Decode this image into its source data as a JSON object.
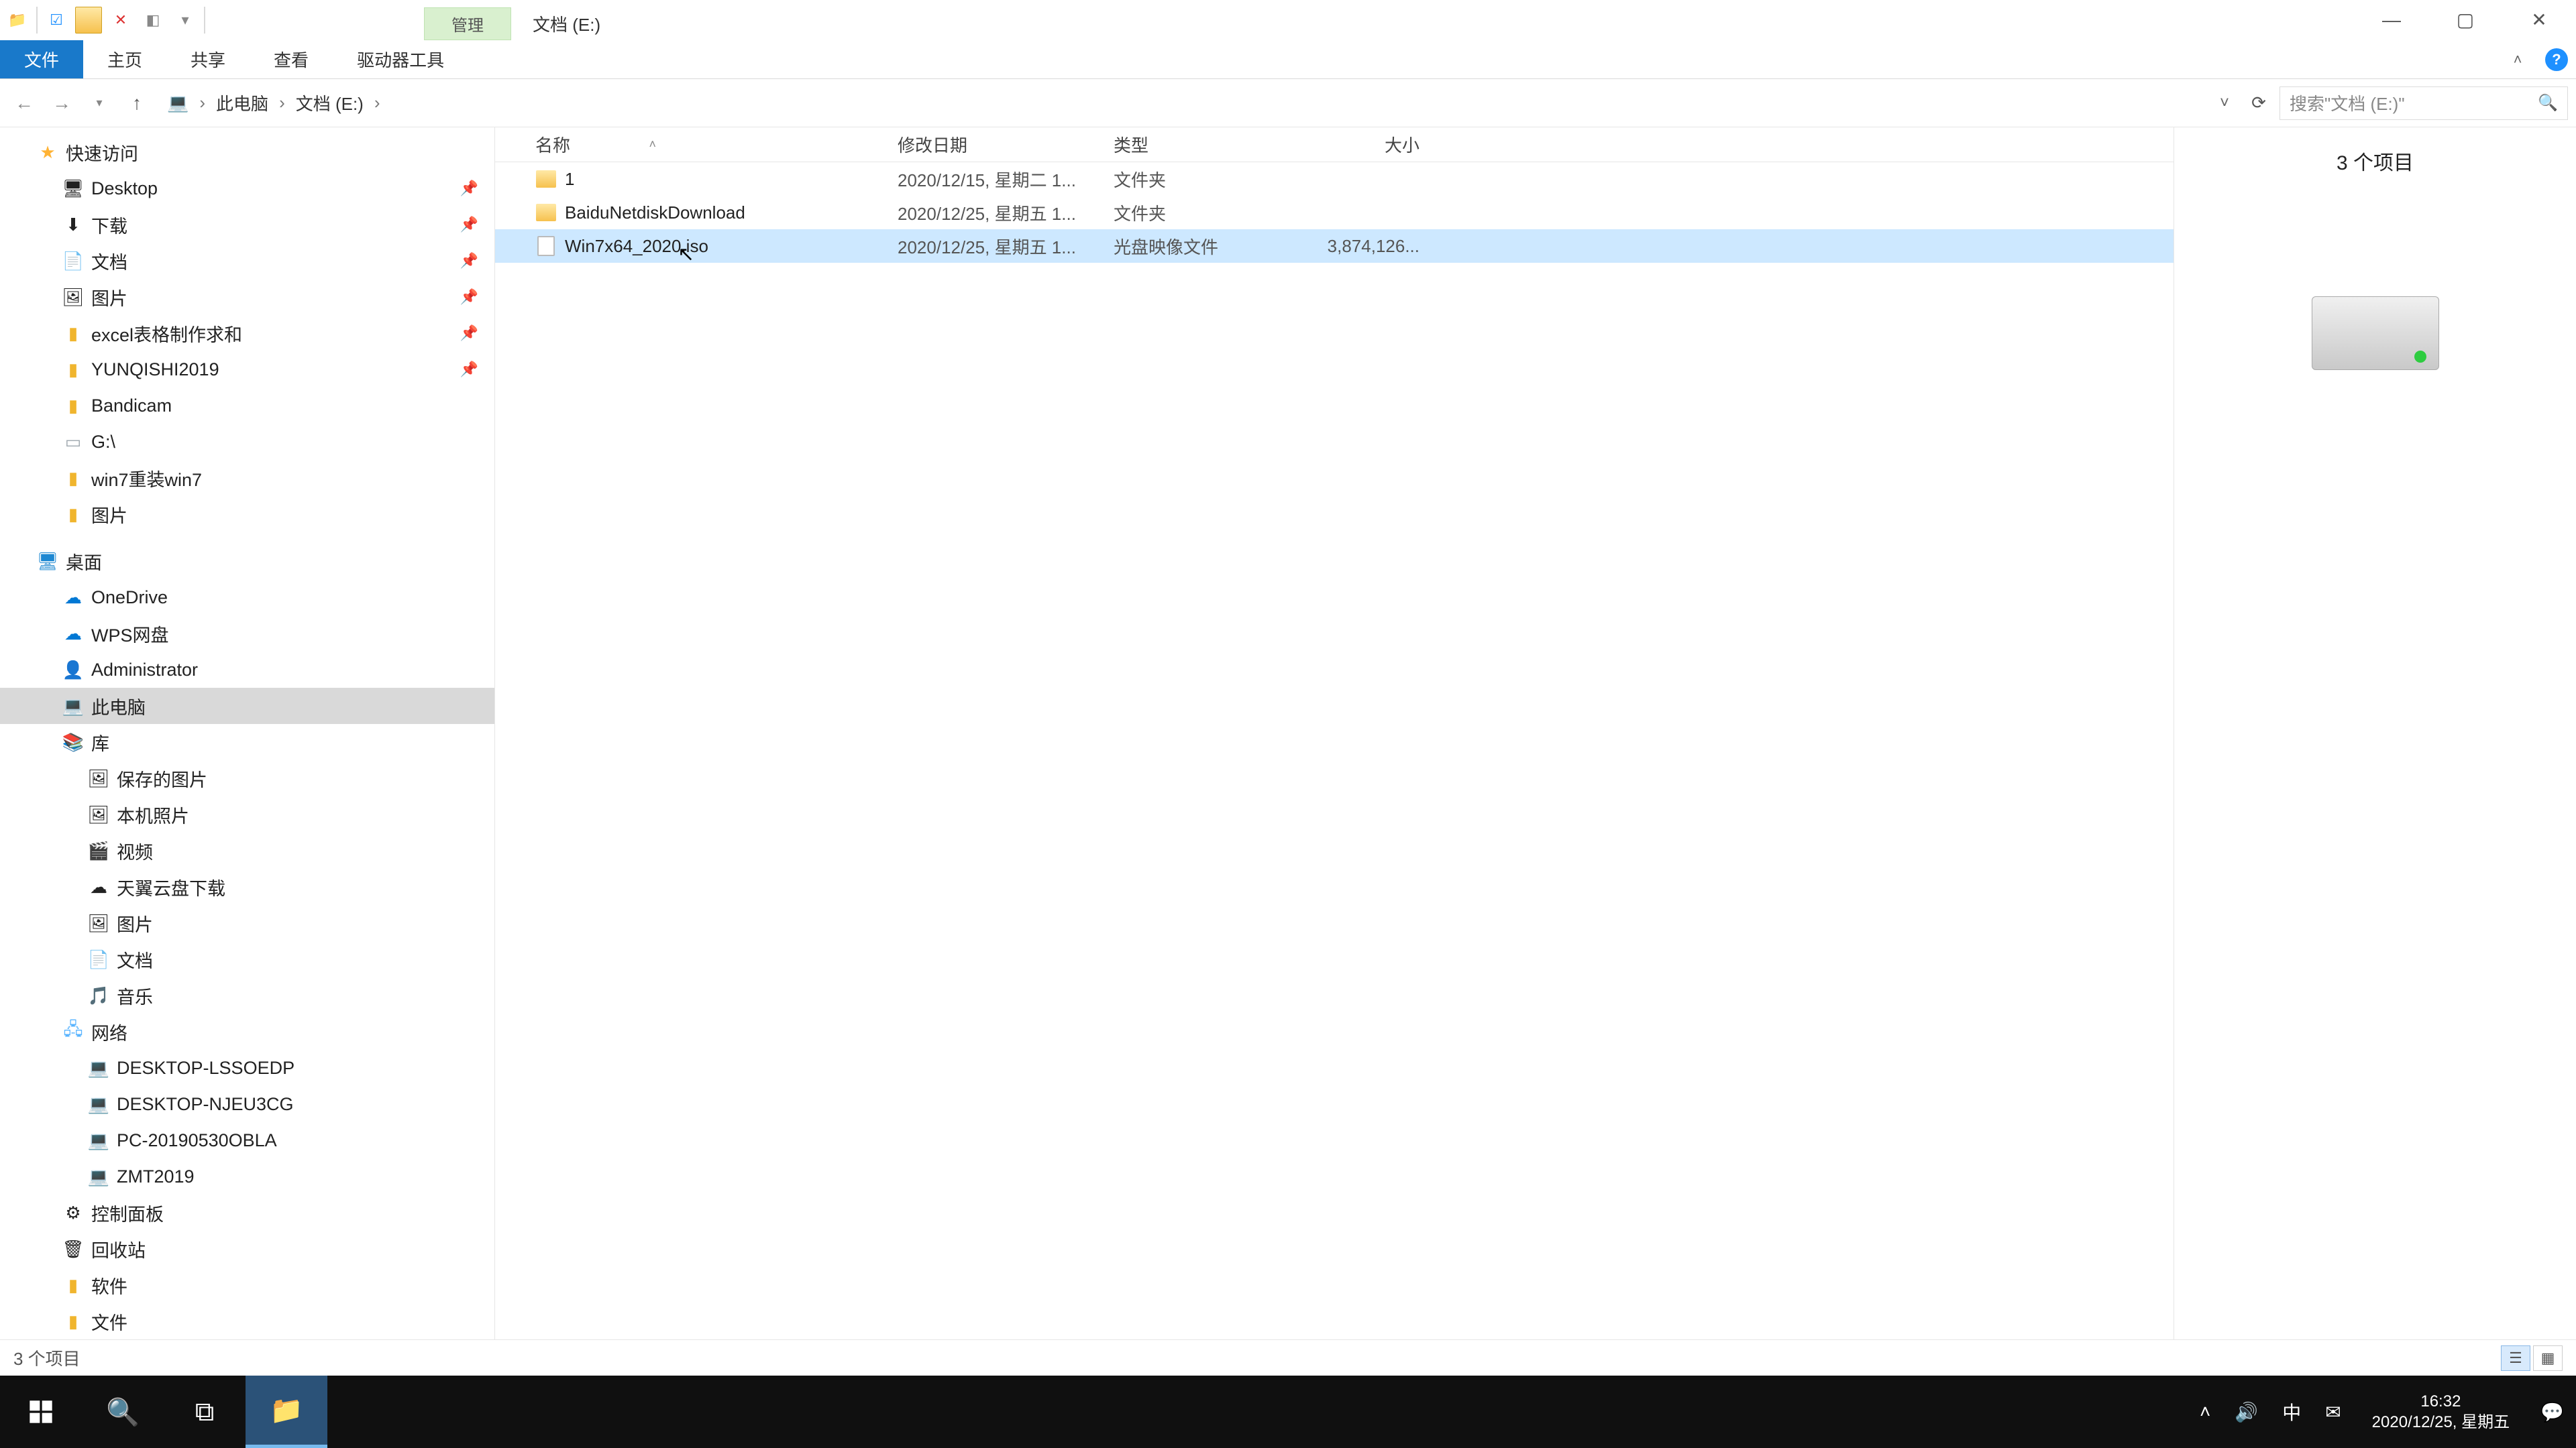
{
  "title_bar": {
    "contextual_tab": "管理",
    "location_title": "文档 (E:)"
  },
  "ribbon": {
    "file": "文件",
    "home": "主页",
    "share": "共享",
    "view": "查看",
    "drive_tools": "驱动器工具"
  },
  "breadcrumb": {
    "this_pc": "此电脑",
    "drive": "文档 (E:)"
  },
  "search": {
    "placeholder": "搜索\"文档 (E:)\""
  },
  "nav": {
    "quick_access": "快速访问",
    "desktop": "Desktop",
    "downloads": "下载",
    "documents": "文档",
    "pictures": "图片",
    "excel": "excel表格制作求和",
    "yunqishi": "YUNQISHI2019",
    "bandicam": "Bandicam",
    "gdrive": "G:\\",
    "win7reinstall": "win7重装win7",
    "pictures2": "图片",
    "desktop_root": "桌面",
    "onedrive": "OneDrive",
    "wps": "WPS网盘",
    "admin": "Administrator",
    "this_pc": "此电脑",
    "library": "库",
    "saved_pics": "保存的图片",
    "camera_roll": "本机照片",
    "videos": "视频",
    "tianyi": "天翼云盘下载",
    "pics_lib": "图片",
    "docs_lib": "文档",
    "music_lib": "音乐",
    "network": "网络",
    "pc1": "DESKTOP-LSSOEDP",
    "pc2": "DESKTOP-NJEU3CG",
    "pc3": "PC-20190530OBLA",
    "pc4": "ZMT2019",
    "control_panel": "控制面板",
    "recycle": "回收站",
    "software": "软件",
    "files": "文件"
  },
  "columns": {
    "name": "名称",
    "date": "修改日期",
    "type": "类型",
    "size": "大小"
  },
  "files": [
    {
      "name": "1",
      "date": "2020/12/15, 星期二 1...",
      "type": "文件夹",
      "size": "",
      "kind": "folder",
      "selected": false
    },
    {
      "name": "BaiduNetdiskDownload",
      "date": "2020/12/25, 星期五 1...",
      "type": "文件夹",
      "size": "",
      "kind": "folder",
      "selected": false
    },
    {
      "name": "Win7x64_2020.iso",
      "date": "2020/12/25, 星期五 1...",
      "type": "光盘映像文件",
      "size": "3,874,126...",
      "kind": "file",
      "selected": true
    }
  ],
  "preview": {
    "count": "3 个项目"
  },
  "status": {
    "text": "3 个项目"
  },
  "tray": {
    "ime": "中",
    "time": "16:32",
    "date": "2020/12/25, 星期五"
  }
}
